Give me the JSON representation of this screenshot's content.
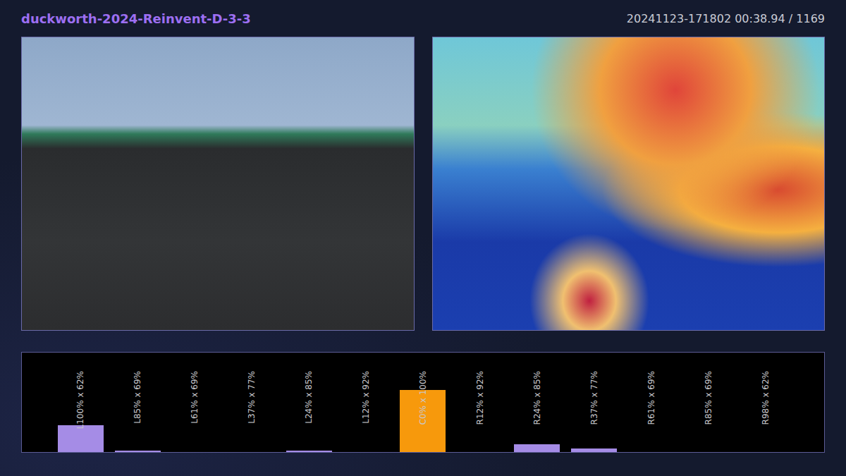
{
  "header": {
    "title": "duckworth-2024-Reinvent-D-3-3",
    "timestamp": "20241123-171802 00:38.94 / 1169"
  },
  "frames": [
    {
      "name": "camera"
    },
    {
      "name": "heatmap"
    }
  ],
  "chart": {
    "bars": [
      {
        "label": "L100% x 62%",
        "value": 0.27,
        "selected": false
      },
      {
        "label": "L85% x 69%",
        "value": 0.015,
        "selected": false
      },
      {
        "label": "L61% x 69%",
        "value": 0,
        "selected": false
      },
      {
        "label": "L37% x 77%",
        "value": 0,
        "selected": false
      },
      {
        "label": "L24% x 85%",
        "value": 0.015,
        "selected": false
      },
      {
        "label": "L12% x 92%",
        "value": 0,
        "selected": false
      },
      {
        "label": "C0% x 100%",
        "value": 0.63,
        "selected": true
      },
      {
        "label": "R12% x 92%",
        "value": 0,
        "selected": false
      },
      {
        "label": "R24% x 85%",
        "value": 0.075,
        "selected": false
      },
      {
        "label": "R37% x 77%",
        "value": 0.035,
        "selected": false
      },
      {
        "label": "R61% x 69%",
        "value": 0,
        "selected": false
      },
      {
        "label": "R85% x 69%",
        "value": 0,
        "selected": false
      },
      {
        "label": "R98% x 62%",
        "value": 0,
        "selected": false
      }
    ]
  }
}
